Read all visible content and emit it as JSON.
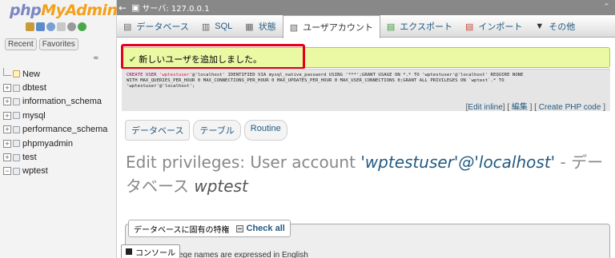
{
  "logo": {
    "part1": "php",
    "part2": "MyAdmin"
  },
  "nav": {
    "tabs": [
      "Recent",
      "Favorites"
    ],
    "collapse_symbol": "∞",
    "databases": [
      "New",
      "dbtest",
      "information_schema",
      "mysql",
      "performance_schema",
      "phpmyadmin",
      "test",
      "wptest"
    ]
  },
  "server": {
    "label": "サーバ: 127.0.0.1"
  },
  "tabs": [
    {
      "label": "データベース",
      "icon": "database-icon"
    },
    {
      "label": "SQL",
      "icon": "sql-icon"
    },
    {
      "label": "状態",
      "icon": "status-icon"
    },
    {
      "label": "ユーザアカウント",
      "icon": "users-icon"
    },
    {
      "label": "エクスポート",
      "icon": "export-icon"
    },
    {
      "label": "インポート",
      "icon": "import-icon"
    },
    {
      "label": "その他",
      "icon": "chevron-down-icon"
    }
  ],
  "message": {
    "text": "新しいユーザを追加しました。"
  },
  "sql": {
    "line1_a": "CREATE USER ",
    "line1_b": "'wptestuser'",
    "line1_c": "@'localhost' IDENTIFIED VIA mysql_native_password USING '***';GRANT USAGE ON *.* TO 'wptestuser'@'localhost' REQUIRE NONE",
    "line2": "WITH MAX_QUERIES_PER_HOUR 0 MAX_CONNECTIONS_PER_HOUR 0 MAX_UPDATES_PER_HOUR 0 MAX_USER_CONNECTIONS 0;GRANT ALL PRIVILEGES ON `wptest`.* TO",
    "line3": "'wptestuser'@'localhost';",
    "edit_inline": "Edit inline",
    "edit": "編集",
    "create_php": "Create PHP code"
  },
  "subtabs": [
    "データベース",
    "テーブル",
    "Routine"
  ],
  "heading": {
    "prefix": "Edit privileges: User account ",
    "account": "'wptestuser'@'localhost'",
    "middle": " - データベース ",
    "db": "wptest"
  },
  "privileges": {
    "legend": "データベースに固有の特権",
    "check_all": "Check all",
    "note": "rivilege names are expressed in English"
  },
  "console": {
    "label": "コンソール"
  }
}
